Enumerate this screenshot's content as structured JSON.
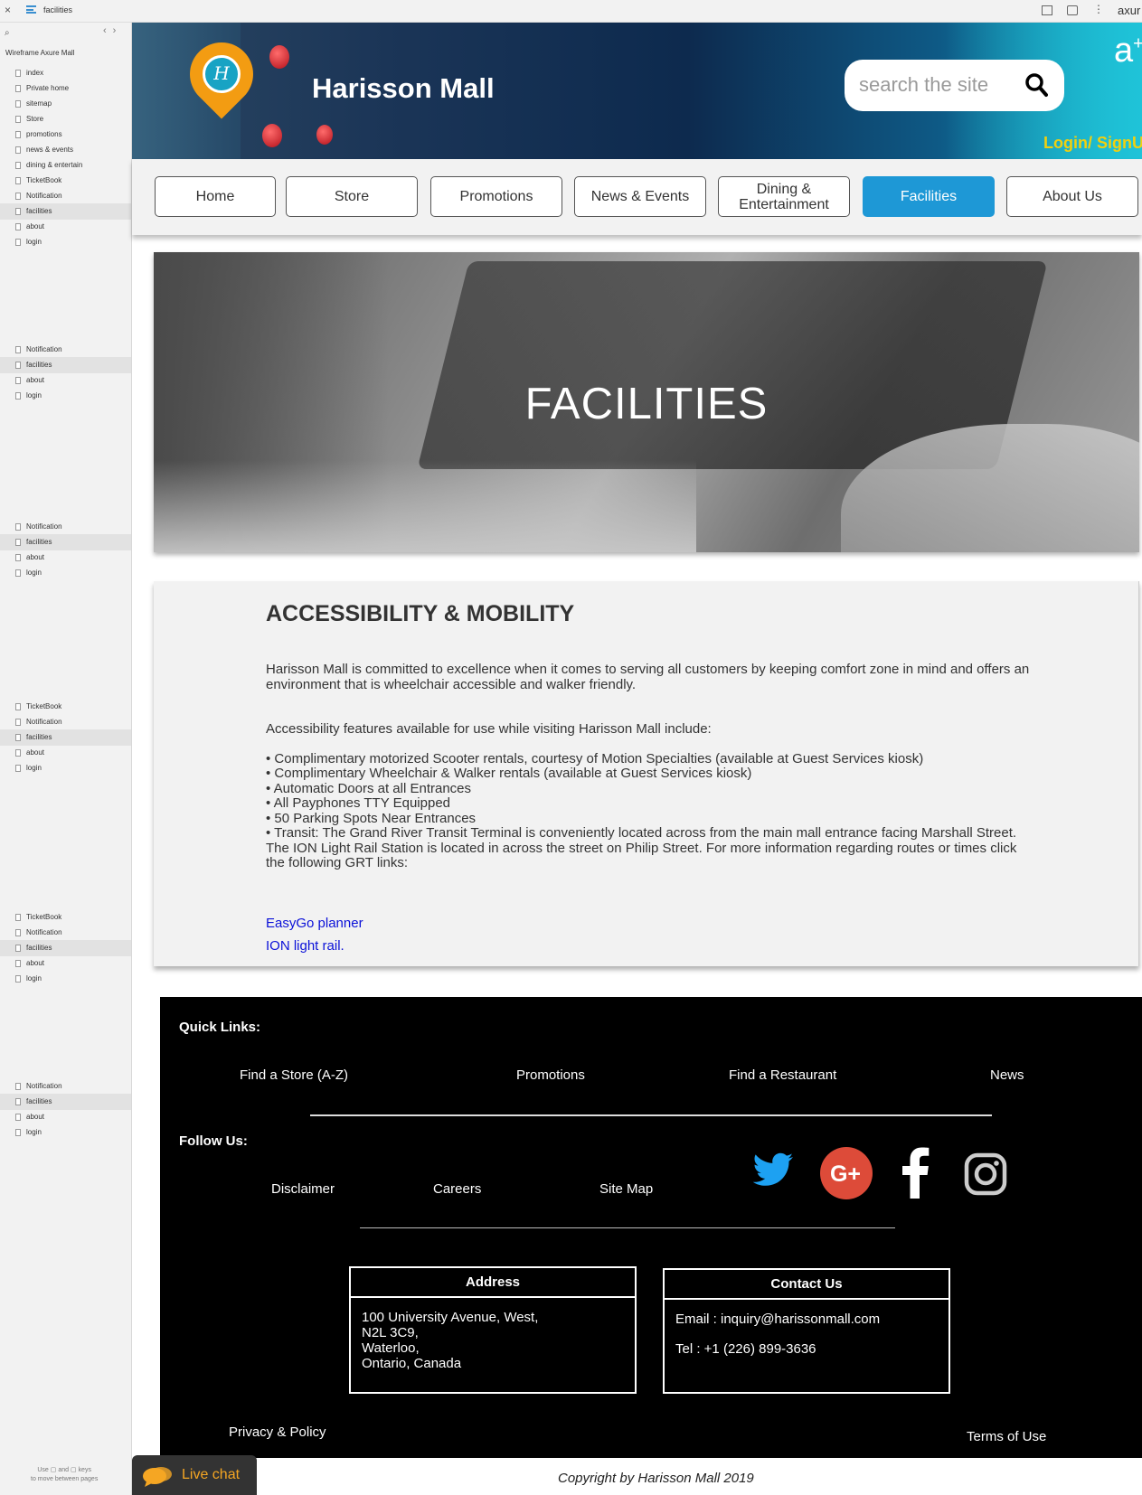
{
  "axure": {
    "page_name": "facilities",
    "brand": "axur",
    "project_title": "Wireframe Axure Mall",
    "hint_line1": "Use",
    "hint_and": "and",
    "hint_keys": "keys",
    "hint_line2": "to move between pages"
  },
  "sitemap": {
    "groups": [
      [
        "index",
        "Private home",
        "sitemap",
        "Store",
        "promotions",
        "news & events",
        "dining & entertain",
        "TicketBook",
        "Notification",
        "facilities",
        "about",
        "login"
      ],
      [
        "Notification",
        "facilities",
        "about",
        "login"
      ],
      [
        "Notification",
        "facilities",
        "about",
        "login"
      ],
      [
        "TicketBook",
        "Notification",
        "facilities",
        "about",
        "login"
      ],
      [
        "TicketBook",
        "Notification",
        "facilities",
        "about",
        "login"
      ],
      [
        "Notification",
        "facilities",
        "about",
        "login"
      ]
    ],
    "active_item": "facilities"
  },
  "header": {
    "site_title": "Harisson Mall",
    "logo_letter": "H",
    "search_placeholder": "search the site",
    "login_label": "Login/ SignUp",
    "a_plus": "a"
  },
  "nav": {
    "items": [
      {
        "label": "Home",
        "active": false
      },
      {
        "label": "Store",
        "active": false
      },
      {
        "label": "Promotions",
        "active": false
      },
      {
        "label": "News & Events",
        "active": false
      },
      {
        "label": "Dining & Entertainment",
        "active": false
      },
      {
        "label": "Facilities",
        "active": true
      },
      {
        "label": "About Us",
        "active": false
      }
    ],
    "active_color": "#1e98d6"
  },
  "hero": {
    "title": "FACILITIES"
  },
  "content": {
    "heading": "ACCESSIBILITY & MOBILITY",
    "intro": "Harisson Mall is committed to excellence when it comes to serving all customers by keeping comfort zone in mind and offers an environment that is wheelchair accessible and walker friendly.",
    "features_lead": "Accessibility features available for use while visiting Harisson Mall include:",
    "bullets": [
      "•    Complimentary motorized Scooter rentals, courtesy of Motion Specialties (available at Guest Services kiosk)",
      "•    Complimentary Wheelchair & Walker rentals (available at Guest Services kiosk)",
      "•    Automatic Doors at all Entrances",
      "•    All Payphones TTY Equipped",
      "•    50 Parking Spots Near Entrances",
      "•    Transit:  The Grand River Transit Terminal is conveniently located across from the main mall entrance facing Marshall Street.  The ION Light Rail Station is located in across the street on Philip Street. For more information regarding routes or times click the following GRT links:"
    ],
    "link1": "EasyGo planner",
    "link2": "ION light rail."
  },
  "footer": {
    "quick_links_label": "Quick Links:",
    "quick_links": [
      "Find a Store (A-Z)",
      "Promotions",
      "Find a Restaurant",
      "News"
    ],
    "follow_label": "Follow Us:",
    "follow_links": [
      "Disclaimer",
      "Careers",
      "Site Map"
    ],
    "social_icons": [
      "twitter-icon",
      "google-plus-icon",
      "facebook-icon",
      "instagram-icon"
    ],
    "social_colors": {
      "twitter": "#1da1f2",
      "google_plus": "#dd4b39"
    },
    "address_title": "Address",
    "address_lines": [
      "100 University Avenue, West,",
      "N2L 3C9,",
      "Waterloo,",
      "Ontario, Canada"
    ],
    "contact_title": "Contact Us",
    "contact_email": "Email : inquiry@harissonmall.com",
    "contact_tel": "Tel : +1 (226) 899-3636",
    "privacy": "Privacy & Policy",
    "terms": "Terms of Use"
  },
  "copyright": "Copyright by Harisson Mall  2019",
  "livechat": {
    "label": "Live chat",
    "color": "#f5a623"
  }
}
